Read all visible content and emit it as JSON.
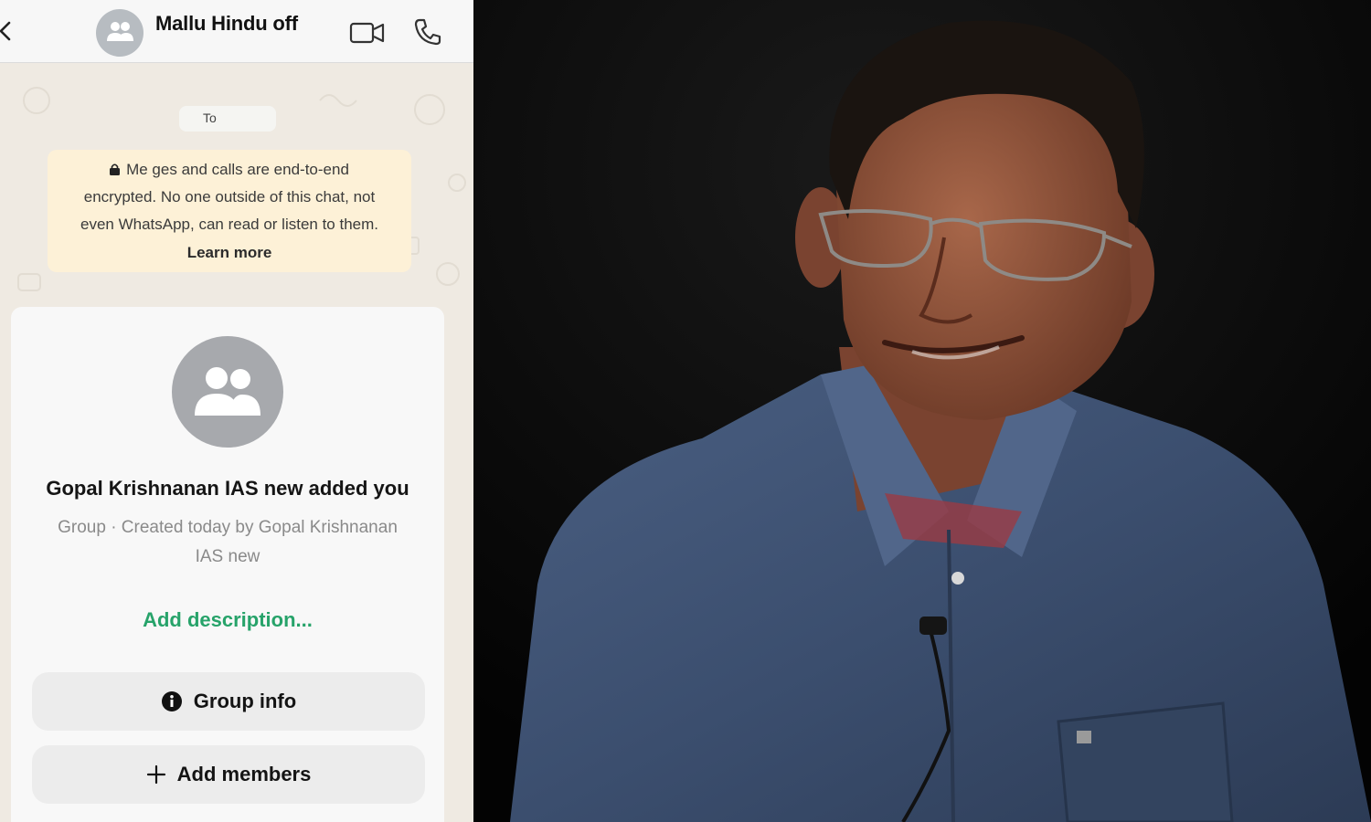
{
  "chat": {
    "title": "Mallu Hindu off",
    "date_chip": "To",
    "encryption_notice": {
      "line1": "Me  ges and calls are end-to-end",
      "line2": "encrypted. No one outside of this chat, not",
      "line3": "even WhatsApp, can read or listen to them.",
      "learn_more": "Learn more"
    },
    "group_card": {
      "title": "Gopal Krishnanan IAS new added you",
      "subtitle_line1": "Group · Created today by Gopal Krishnanan",
      "subtitle_line2": "IAS new",
      "add_description": "Add description...",
      "group_info_label": "Group info",
      "add_members_label": "Add members"
    }
  },
  "colors": {
    "chat_background": "#efeae2",
    "notice_background": "#fdf1d7",
    "accent_green": "#27a36a",
    "avatar_grey": "#a7a9ad"
  },
  "icons": [
    "back-icon",
    "group-avatar-icon",
    "video-call-icon",
    "voice-call-icon",
    "lock-icon",
    "info-icon",
    "plus-icon"
  ]
}
